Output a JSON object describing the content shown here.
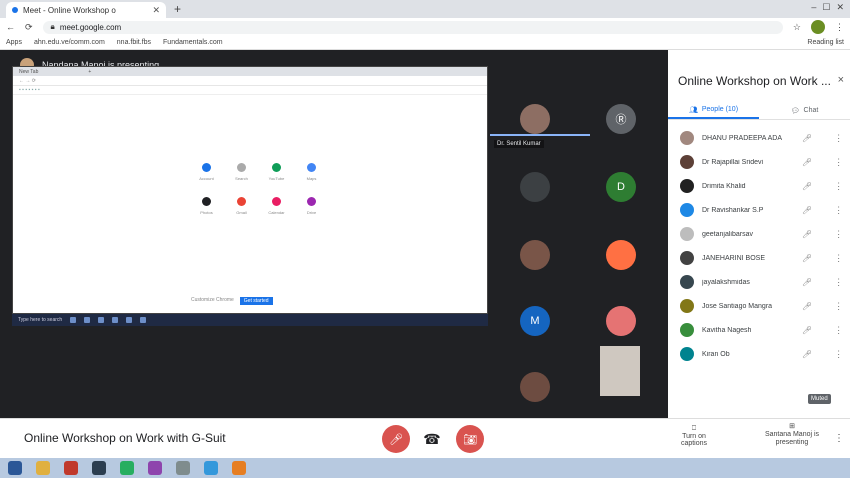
{
  "browser": {
    "tab_title": "Meet - Online Workshop o",
    "new_tab": "+",
    "url_host": "meet.google.com",
    "window_controls": [
      "–",
      "☐",
      "✕"
    ],
    "bookmarks": [
      "Apps",
      "ahn.edu.ve/comm.com",
      "nna.fbit.fbs",
      "Fundamentals.com"
    ],
    "bookmarks_right": "Reading list"
  },
  "stage": {
    "presenting_text": "Nandana Manoj is presenting",
    "tile_label": "Dr. Sentil Kumar",
    "tiles": [
      {
        "letter": "",
        "color": "#8d6e63"
      },
      {
        "letter": "Ⓡ",
        "color": "#5f6368"
      },
      {
        "letter": "",
        "color": "#3c4043"
      },
      {
        "letter": "D",
        "color": "#2e7d32"
      },
      {
        "letter": "",
        "color": "#795548"
      },
      {
        "letter": "",
        "color": "#ff7043"
      },
      {
        "letter": "M",
        "color": "#1565c0"
      },
      {
        "letter": "",
        "color": "#e57373"
      },
      {
        "letter": "",
        "color": "#6d4c41"
      }
    ],
    "shared": {
      "tabs": [
        "New Tab",
        "+"
      ],
      "apps": [
        {
          "label": "Account",
          "color": "#1a73e8"
        },
        {
          "label": "Search",
          "color": "#aaaaaa"
        },
        {
          "label": "YouTube",
          "color": "#0f9d58"
        },
        {
          "label": "Maps",
          "color": "#4285f4"
        },
        {
          "label": "Photos",
          "color": "#202124"
        },
        {
          "label": "Gmail",
          "color": "#ea4335"
        },
        {
          "label": "Calendar",
          "color": "#e91e63"
        },
        {
          "label": "Drive",
          "color": "#9c27b0"
        }
      ],
      "footer_a": "Customize Chrome",
      "footer_b": "Get started",
      "taskbar_text": "Type here to search"
    }
  },
  "bottom": {
    "meeting_title": "Online Workshop on Work with G-Suit",
    "captions": "Turn on captions",
    "presenter": "Santana Manoj is presenting",
    "more": "⋮"
  },
  "panel": {
    "title": "Online Workshop on Work ...",
    "close": "×",
    "tab_people": "People (10)",
    "tab_chat": "Chat",
    "participants": [
      {
        "name": "DHANU PRADEEPA ADA",
        "color": "#a1887f"
      },
      {
        "name": "Dr Rajapillai Sridevi",
        "color": "#5d4037"
      },
      {
        "name": "Drimita Khalid",
        "color": "#212121"
      },
      {
        "name": "Dr Ravishankar S.P",
        "color": "#1e88e5"
      },
      {
        "name": "geetanjalibarsav",
        "color": "#bdbdbd"
      },
      {
        "name": "JANEHARINI BOSE",
        "color": "#424242"
      },
      {
        "name": "jayalakshmidas",
        "color": "#37474f"
      },
      {
        "name": "Jose Santiago Mangra",
        "color": "#827717"
      },
      {
        "name": "Kavitha Nagesh",
        "color": "#388e3c"
      },
      {
        "name": "Kiran Ob",
        "color": "#00838f"
      }
    ],
    "tooltip": "Muted"
  }
}
